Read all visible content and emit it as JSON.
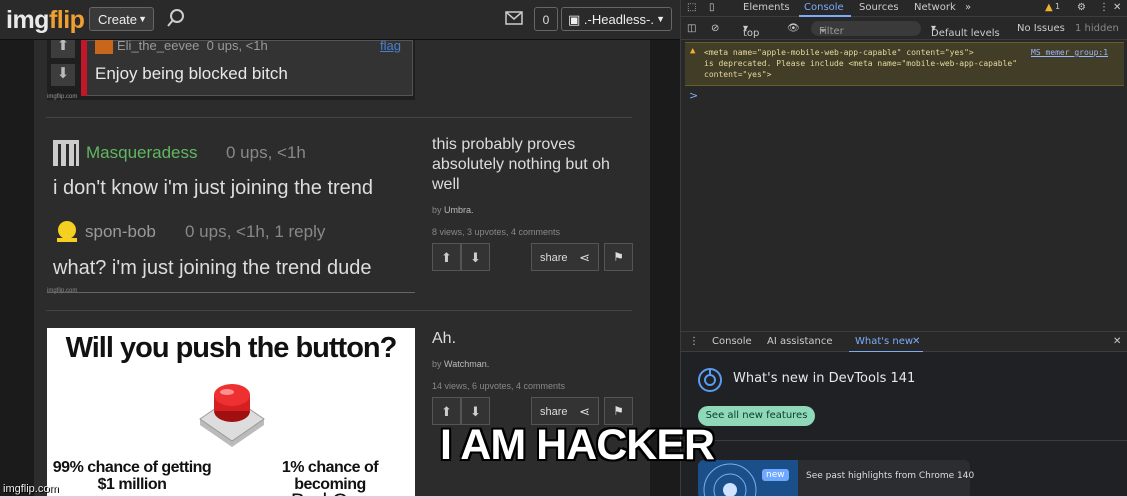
{
  "site": {
    "logo_a": "img",
    "logo_b": "flip",
    "create_label": "Create",
    "notif_count": "0",
    "username": ".-Headless-.",
    "watermark": "imgflip.com"
  },
  "posts": [
    {
      "image": {
        "commenter": "Eli_the_eevee",
        "meta": "0 ups, <1h",
        "flag": "flag",
        "text": "Enjoy being blocked bitch",
        "watermark": "imgflip.com"
      }
    },
    {
      "image": {
        "user1": "Masqueradess",
        "meta1": "0 ups, <1h",
        "text1": "i don't know i'm just joining the trend",
        "user2": "spon-bob",
        "meta2": "0 ups, <1h, 1 reply",
        "text2": "what? i'm just joining the trend dude",
        "watermark": "imgflip.com"
      },
      "title": "this probably proves absolutely nothing but oh well",
      "by": "by",
      "author": "Umbra.",
      "stats": "8 views, 3 upvotes, 4 comments",
      "share": "share"
    },
    {
      "image": {
        "headline": "Will you push the button?",
        "left_text": "99% chance of getting $1 million",
        "right_text_a": "1% chance of becoming",
        "right_text_b": "Bad Cop"
      },
      "title": "Ah.",
      "by": "by",
      "author": "Watchman.",
      "stats": "14 views, 6 upvotes, 4 comments",
      "share": "share"
    }
  ],
  "overlay_caption": "I AM HACKER",
  "devtools": {
    "tabs": [
      "Elements",
      "Console",
      "Sources",
      "Network"
    ],
    "warn_count": "1",
    "context": "top",
    "filter_placeholder": "Filter",
    "levels": "Default levels",
    "issues": "No Issues",
    "hidden": "1 hidden",
    "warning_msg": "<meta name=\"apple-mobile-web-app-capable\" content=\"yes\">\nis deprecated. Please include <meta name=\"mobile-web-app-capable\"\ncontent=\"yes\">",
    "warning_src": "MS_memer_group:1",
    "prompt": ">",
    "drawer_tabs": [
      "Console",
      "AI assistance",
      "What's new"
    ],
    "whats_new_title": "What's new in DevTools 141",
    "see_all": "See all new features",
    "new_badge": "new",
    "card_text": "See past highlights from Chrome 140"
  },
  "colors": {
    "brand_orange": "#f0a030",
    "devtools_accent": "#7cacf8",
    "warning_bg": "#413d26",
    "green_user": "#5fb85f"
  }
}
